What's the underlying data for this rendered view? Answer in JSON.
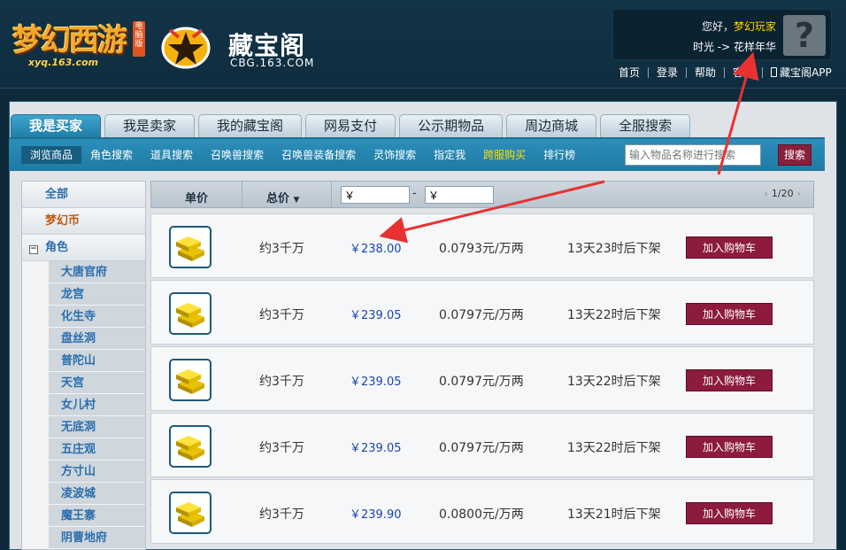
{
  "header": {
    "game_logo": {
      "text": "梦幻西游",
      "domain": "xyq.163.com",
      "badge": "电脑版"
    },
    "cbg_logo": {
      "name": "藏宝阁",
      "url": "CBG.163.COM"
    },
    "user": {
      "greeting_prefix": "您好，",
      "player_name": "梦幻玩家",
      "server_label": "时光 -> 花样年华",
      "avatar_icon": "question-mark-icon"
    },
    "topnav": [
      "首页",
      "登录",
      "帮助",
      "客服",
      "藏宝阁APP"
    ]
  },
  "tabs": [
    {
      "label": "我是买家",
      "active": true
    },
    {
      "label": "我是卖家",
      "active": false
    },
    {
      "label": "我的藏宝阁",
      "active": false
    },
    {
      "label": "网易支付",
      "active": false
    },
    {
      "label": "公示期物品",
      "active": false
    },
    {
      "label": "周边商城",
      "active": false
    },
    {
      "label": "全服搜索",
      "active": false
    }
  ],
  "subnav": {
    "links": [
      {
        "label": "浏览商品",
        "state": "active"
      },
      {
        "label": "角色搜索",
        "state": ""
      },
      {
        "label": "道具搜索",
        "state": ""
      },
      {
        "label": "召唤兽搜索",
        "state": ""
      },
      {
        "label": "召唤兽装备搜索",
        "state": ""
      },
      {
        "label": "灵饰搜索",
        "state": ""
      },
      {
        "label": "指定我",
        "state": ""
      },
      {
        "label": "跨服购买",
        "state": "highlight"
      },
      {
        "label": "排行榜",
        "state": ""
      }
    ],
    "search_placeholder": "输入物品名称进行搜索",
    "search_button": "搜索"
  },
  "sidebar": {
    "all": "全部",
    "currency": "梦幻币",
    "category": {
      "toggle": "−",
      "label": "角色"
    },
    "schools": [
      "大唐官府",
      "龙宫",
      "化生寺",
      "盘丝洞",
      "普陀山",
      "天宫",
      "女儿村",
      "无底洞",
      "五庄观",
      "方寸山",
      "凌波城",
      "魔王寨",
      "阴曹地府"
    ]
  },
  "table": {
    "col_unit_price": "单价",
    "col_total_price": "总价",
    "min_price": "￥",
    "max_price": "￥",
    "dash": "-",
    "pager": "1/20",
    "pager_prev": "‹",
    "pager_next": "›",
    "rows": [
      {
        "qty": "约3千万",
        "price": "￥238.00",
        "unit": "0.0793元/万两",
        "time": "13天23时后下架",
        "button": "加入购物车"
      },
      {
        "qty": "约3千万",
        "price": "￥239.05",
        "unit": "0.0797元/万两",
        "time": "13天22时后下架",
        "button": "加入购物车"
      },
      {
        "qty": "约3千万",
        "price": "￥239.05",
        "unit": "0.0797元/万两",
        "time": "13天22时后下架",
        "button": "加入购物车"
      },
      {
        "qty": "约3千万",
        "price": "￥239.05",
        "unit": "0.0797元/万两",
        "time": "13天22时后下架",
        "button": "加入购物车"
      },
      {
        "qty": "约3千万",
        "price": "￥239.90",
        "unit": "0.0800元/万两",
        "time": "13天21时后下架",
        "button": "加入购物车"
      }
    ]
  },
  "colors": {
    "accent": "#1f7aa3",
    "cart_button": "#8c1b3e",
    "price": "#1a45b0",
    "annotation_arrow": "#e83232"
  }
}
